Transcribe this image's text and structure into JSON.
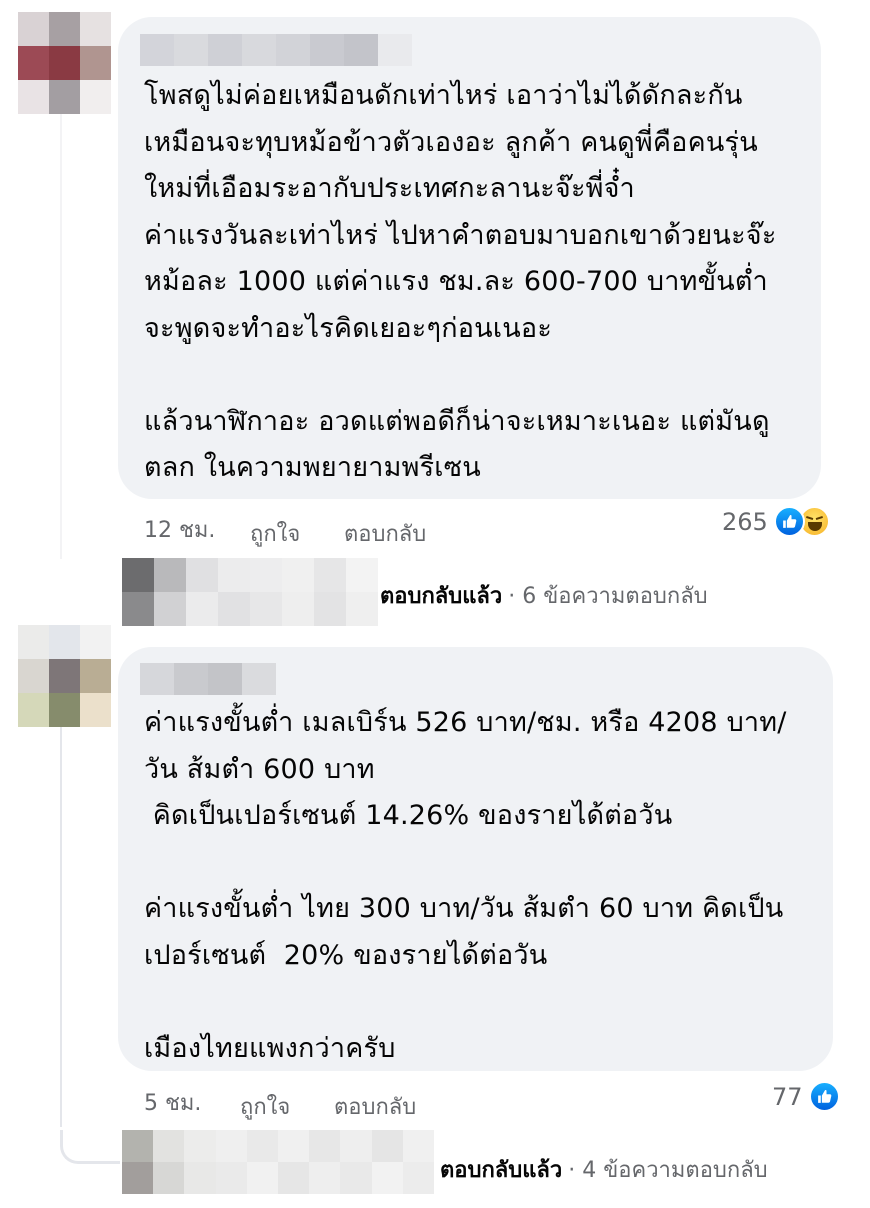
{
  "comments": [
    {
      "text": "โพสดูไม่ค่อยเหมือนดักเท่าไหร่ เอาว่าไม่ได้ดักละกัน\nเหมือนจะทุบหม้อข้าวตัวเองอะ ลูกค้า คนดูพี่คือคนรุ่น\nใหม่ที่เอือมระอากับประเทศกะลานะจ๊ะพี่จ๋ำ\nค่าแรงวันละเท่าไหร่ ไปหาคำตอบมาบอกเขาด้วยนะจ๊ะ\nหม้อละ 1000 แต่ค่าแรง ชม.ละ 600-700 บาทขั้นต่ำ\nจะพูดจะทำอะไรคิดเยอะๆก่อนเนอะ\n\nแล้วนาฬิกาอะ อวดแต่พอดีก็น่าจะเหมาะเนอะ แต่มันดู\nตลก ในความพยายามพรีเซน",
      "time": "12 ชม.",
      "like_label": "ถูกใจ",
      "reply_label": "ตอบกลับ",
      "reaction_count": "265",
      "replies_label": "ตอบกลับแล้ว",
      "replies_count": "· 6 ข้อความตอบกลับ"
    },
    {
      "text": "ค่าแรงขั้นต่ำ เมลเบิร์น 526 บาท/ชม. หรือ 4208 บาท/\nวัน ส้มตำ 600 บาท\n คิดเป็นเปอร์เซนต์ 14.26% ของรายได้ต่อวัน\n\nค่าแรงขั้นต่ำ ไทย 300 บาท/วัน ส้มตำ 60 บาท คิดเป็น\nเปอร์เซนต์  20% ของรายได้ต่อวัน\n\nเมืองไทยแพงกว่าครับ",
      "time": "5 ชม.",
      "like_label": "ถูกใจ",
      "reply_label": "ตอบกลับ",
      "reaction_count": "77",
      "replies_label": "ตอบกลับแล้ว",
      "replies_count": "· 4 ข้อความตอบกลับ"
    }
  ],
  "colors": {
    "bubble": "#f0f2f5",
    "meta_text": "#65676b",
    "like_blue": "#1877f2",
    "haha_yellow": "#f7b125"
  },
  "icons": [
    "like-reaction-icon",
    "haha-reaction-icon"
  ]
}
